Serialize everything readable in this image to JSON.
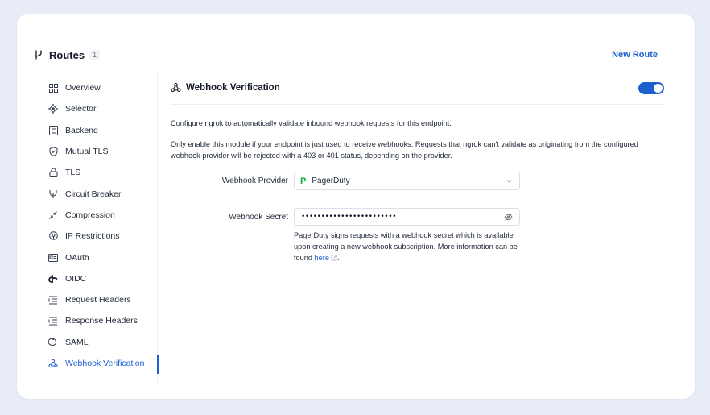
{
  "header": {
    "title": "Routes",
    "count": "1",
    "new_route_label": "New Route"
  },
  "sidebar": {
    "items": [
      {
        "label": "Overview",
        "icon": "grid-icon"
      },
      {
        "label": "Selector",
        "icon": "crosshair-icon"
      },
      {
        "label": "Backend",
        "icon": "server-icon"
      },
      {
        "label": "Mutual TLS",
        "icon": "shield-icon"
      },
      {
        "label": "TLS",
        "icon": "lock-icon"
      },
      {
        "label": "Circuit Breaker",
        "icon": "circuit-icon"
      },
      {
        "label": "Compression",
        "icon": "compress-icon"
      },
      {
        "label": "IP Restrictions",
        "icon": "location-pin-icon"
      },
      {
        "label": "OAuth",
        "icon": "id-card-icon"
      },
      {
        "label": "OIDC",
        "icon": "oidc-icon"
      },
      {
        "label": "Request Headers",
        "icon": "headers-icon"
      },
      {
        "label": "Response Headers",
        "icon": "headers-icon"
      },
      {
        "label": "SAML",
        "icon": "saml-icon"
      },
      {
        "label": "Webhook Verification",
        "icon": "webhook-icon",
        "active": true
      }
    ]
  },
  "main": {
    "section_title": "Webhook Verification",
    "enabled": true,
    "description_1": "Configure ngrok to automatically validate inbound webhook requests for this endpoint.",
    "description_2": "Only enable this module if your endpoint is just used to receive webhooks. Requests that ngrok can't validate as originating from the configured webhook provider will be rejected with a 403 or 401 status, depending on the provider.",
    "provider_label": "Webhook Provider",
    "provider_value": "PagerDuty",
    "provider_logo": "P",
    "secret_label": "Webhook Secret",
    "secret_value": "••••••••••••••••••••••••",
    "help_text": "PagerDuty signs requests with a webhook secret which is available upon creating a new webhook subscription. More information can be found ",
    "help_link": "here",
    "help_suffix": "."
  },
  "colors": {
    "accent": "#1d5fd1",
    "background": "#e8ecf6",
    "pagerduty_green": "#06ac38"
  }
}
